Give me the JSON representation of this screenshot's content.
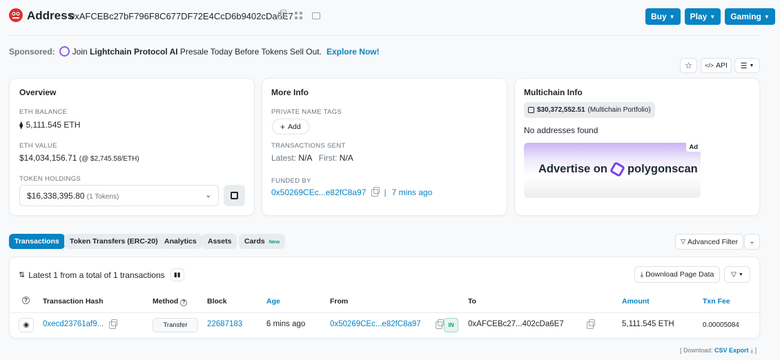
{
  "header": {
    "title": "Address",
    "address": "0xAFCEBc27bF796F8C677DF72E4CcD6b9402cDa6E7",
    "buttons": [
      "Buy",
      "Play",
      "Gaming"
    ]
  },
  "sponsored": {
    "label": "Sponsored:",
    "text_pre": "Join ",
    "text_bold": "Lightchain Protocol AI",
    "text_post": " Presale Today Before Tokens Sell Out.",
    "cta": "Explore Now!"
  },
  "toolbar": {
    "api_label": "API"
  },
  "overview": {
    "title": "Overview",
    "eth_balance_label": "ETH BALANCE",
    "eth_balance": "5,111.545 ETH",
    "eth_value_label": "ETH VALUE",
    "eth_value": "$14,034,156.71",
    "eth_price": "(@ $2,745.58/ETH)",
    "token_holdings_label": "TOKEN HOLDINGS",
    "token_holdings_value": "$16,338,395.80",
    "token_holdings_count": "(1 Tokens)"
  },
  "more_info": {
    "title": "More Info",
    "private_tags_label": "PRIVATE NAME TAGS",
    "add_label": "Add",
    "tx_sent_label": "TRANSACTIONS SENT",
    "latest_label": "Latest:",
    "latest_value": "N/A",
    "first_label": "First:",
    "first_value": "N/A",
    "funded_by_label": "FUNDED BY",
    "funded_by_address": "0x50269CEc...e82fC8a97",
    "funded_by_age": "7 mins ago"
  },
  "multichain": {
    "title": "Multichain Info",
    "portfolio_value": "$30,372,552.51",
    "portfolio_label": "(Multichain Portfolio)",
    "no_addresses": "No addresses found",
    "ad_badge": "Ad",
    "ad_text": "Advertise on",
    "ad_brand": "polygonscan"
  },
  "tabs": [
    {
      "label": "Transactions",
      "active": true
    },
    {
      "label": "Token Transfers (ERC-20)"
    },
    {
      "label": "Analytics"
    },
    {
      "label": "Assets"
    },
    {
      "label": "Cards",
      "badge": "New"
    }
  ],
  "advanced_filter_label": "Advanced Filter",
  "table": {
    "summary": "Latest 1 from a total of 1 transactions",
    "download_label": "Download Page Data",
    "headers": [
      "Transaction Hash",
      "Method",
      "Block",
      "Age",
      "From",
      "To",
      "Amount",
      "Txn Fee"
    ],
    "rows": [
      {
        "hash": "0xecd23761af9...",
        "method": "Transfer",
        "block": "22687183",
        "age": "6 mins ago",
        "from": "0x50269CEc...e82fC8a97",
        "direction": "IN",
        "to": "0xAFCEBc27...402cDa6E7",
        "amount": "5,111.545 ETH",
        "fee": "0.00005084"
      }
    ]
  },
  "footer": {
    "download_prefix": "[ Download:",
    "csv_label": "CSV Export",
    "suffix": "]"
  },
  "colors": {
    "accent": "#0784c3",
    "in_badge_bg": "#e6f4ee",
    "in_badge_fg": "#00a186"
  }
}
